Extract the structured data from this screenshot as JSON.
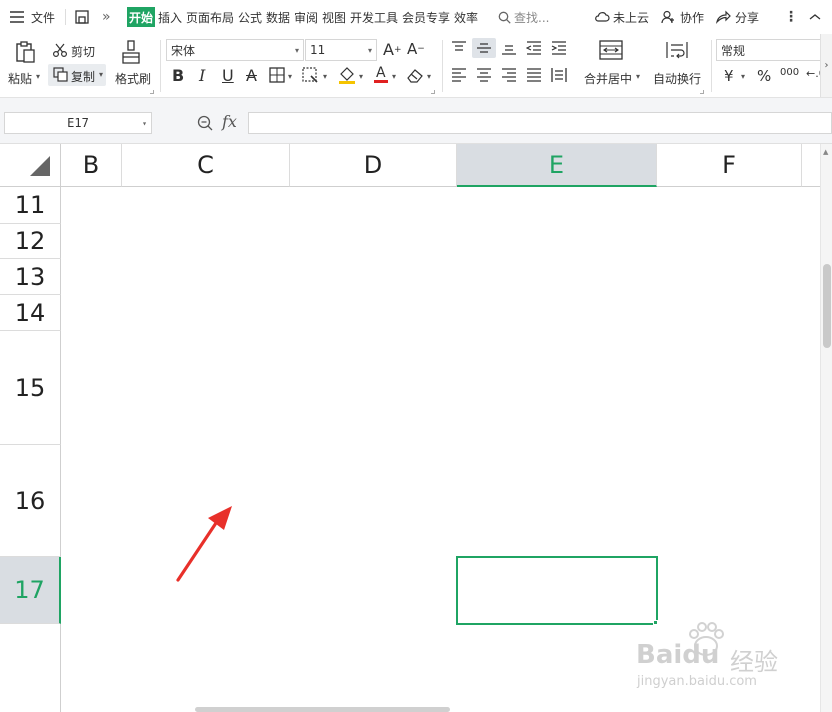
{
  "menubar": {
    "menu_label": "文件",
    "tabs": [
      "开始",
      "插入",
      "页面布局",
      "公式",
      "数据",
      "审阅",
      "视图",
      "开发工具",
      "会员专享",
      "效率"
    ],
    "search_placeholder": "查找...",
    "cloud_label": "未上云",
    "collab_label": "协作",
    "share_label": "分享"
  },
  "ribbon": {
    "paste_label": "粘贴",
    "cut_label": "剪切",
    "copy_label": "复制",
    "format_painter_label": "格式刷",
    "font_name": "宋体",
    "font_size": "11",
    "bold": "B",
    "italic": "I",
    "underline": "U",
    "merge_label": "合并居中",
    "wrap_label": "自动换行",
    "number_format": "常规",
    "currency_symbol": "¥",
    "percent_symbol": "%",
    "thousands_symbol": "000"
  },
  "formula_bar": {
    "cell_ref": "E17",
    "fx_label": "fx",
    "formula_value": ""
  },
  "sheet": {
    "columns": [
      "B",
      "C",
      "D",
      "E",
      "F"
    ],
    "rows": [
      "11",
      "12",
      "13",
      "14",
      "15",
      "16",
      "17"
    ],
    "selected_column": "E",
    "selected_row": "17"
  },
  "watermark": {
    "brand": "Baidu",
    "sub": "经验",
    "url": "jingyan.baidu.com"
  },
  "colors": {
    "accent": "#1fa463",
    "annotation_arrow": "#e8302a"
  }
}
